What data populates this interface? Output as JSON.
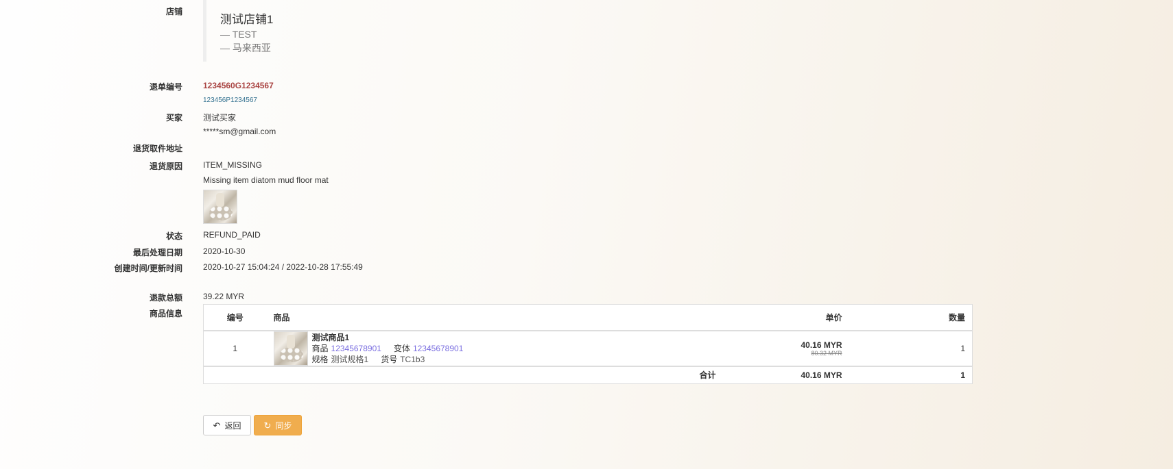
{
  "labels": {
    "shop": "店铺",
    "return_no": "退单编号",
    "buyer": "买家",
    "return_address": "退货取件地址",
    "return_reason": "退货原因",
    "status": "状态",
    "last_process_date": "最后处理日期",
    "created_updated": "创建时间/更新时间",
    "refund_total": "退款总额",
    "product_info": "商品信息"
  },
  "shop": {
    "name": "测试店铺1",
    "account": "— TEST",
    "region": "— 马来西亚"
  },
  "return_no": "1234560G1234567",
  "order_no": "123456P1234567",
  "buyer": {
    "name": "测试买家",
    "email": "*****sm@gmail.com"
  },
  "return_reason": {
    "code": "ITEM_MISSING",
    "text": "Missing item diatom mud floor mat",
    "image_icon": "product-photo"
  },
  "status": "REFUND_PAID",
  "last_process_date": "2020-10-30",
  "created_updated": "2020-10-27 15:04:24 / 2022-10-28 17:55:49",
  "refund_total": "39.22 MYR",
  "table": {
    "headers": {
      "no": "编号",
      "goods": "商品",
      "price": "单价",
      "qty": "数量"
    },
    "rows": [
      {
        "no": "1",
        "title": "测试商品1",
        "item_label": "商品",
        "item_id": "12345678901",
        "variant_label": "变体",
        "variant_id": "12345678901",
        "spec_label": "规格",
        "spec_value": "测试规格1",
        "sku_label": "货号",
        "sku_value": "TC1b3",
        "price": "40.16 MYR",
        "original_price": "80.32 MYR",
        "qty": "1"
      }
    ],
    "footer": {
      "label": "合计",
      "price": "40.16 MYR",
      "qty": "1"
    }
  },
  "buttons": {
    "back": "返回",
    "back_icon": "reply-icon",
    "sync": "同步",
    "sync_icon": "refresh-icon"
  },
  "colors": {
    "order_no": "#a94442",
    "sub_order": "#31708f",
    "link": "#7b6fe0",
    "sync_button": "#f0ad4e"
  }
}
